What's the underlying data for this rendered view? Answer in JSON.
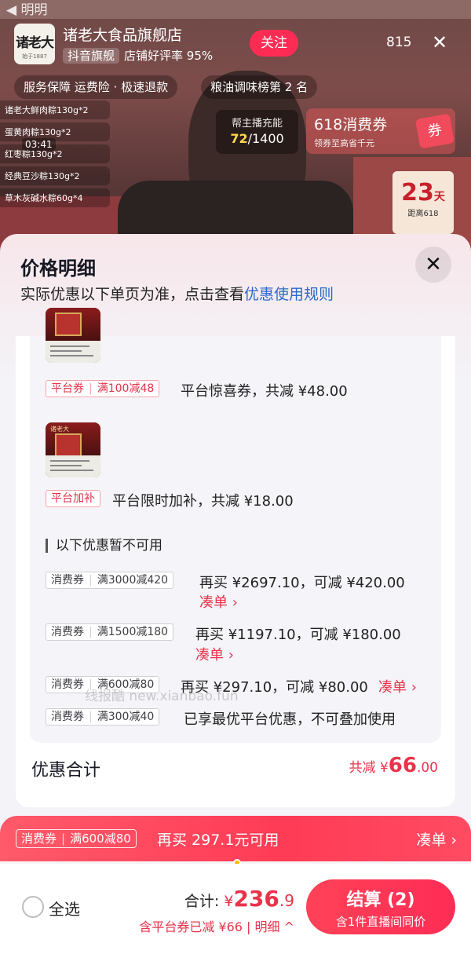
{
  "stream": {
    "top_strip": "◀ 明明",
    "shop_logo_text": "诸老大",
    "shop_logo_sub": "始于1887",
    "shop_name": "诸老大食品旗舰店",
    "shop_tag": "抖音旗舰",
    "shop_rating": "店铺好评率 95%",
    "follow": "关注",
    "viewers": "815",
    "service_chip": "服务保障  运费险 · 极速退款",
    "rank_chip": "粮油调味榜第 2 名",
    "product_items": [
      "诸老大鲜肉粽130g*2",
      "蛋黄肉粽130g*2",
      "红枣粽130g*2",
      "经典豆沙粽130g*2",
      "草木灰碱水粽60g*4"
    ],
    "video_time": "03:41",
    "help_title": "帮主播充能",
    "help_progress": "72",
    "help_total": "/1400",
    "coupon_title": "618消费券",
    "coupon_sub": "领券至高省千元",
    "coupon_mark": "券",
    "countdown_num": "23",
    "countdown_unit": "天",
    "countdown_sub": "距离618"
  },
  "sheet": {
    "title": "价格明细",
    "subtitle": "实际优惠以下单页为准，点击查看",
    "subtitle_link": "优惠使用规则",
    "close": "✕",
    "discounts": [
      {
        "type": "平台券",
        "rule": "满100减48",
        "desc": "平台惊喜券，共减 ¥48.00"
      },
      {
        "type": "平台加补",
        "desc": "平台限时加补，共减 ¥18.00"
      }
    ],
    "product_brand": "诸老大",
    "unavailable_title": "以下优惠暂不可用",
    "unavailable": [
      {
        "type": "消费券",
        "rule": "满3000减420",
        "desc": "再买 ¥2697.10，可减 ¥420.00",
        "action": "凑单 ›"
      },
      {
        "type": "消费券",
        "rule": "满1500减180",
        "desc": "再买 ¥1197.10，可减 ¥180.00",
        "action": "凑单 ›"
      },
      {
        "type": "消费券",
        "rule": "满600减80",
        "desc": "再买 ¥297.10，可减 ¥80.00",
        "action": "凑单 ›"
      },
      {
        "type": "消费券",
        "rule": "满300减40",
        "desc": "已享最优平台优惠，不可叠加使用"
      }
    ],
    "total_label": "优惠合计",
    "total_prefix": "共减 ¥",
    "total_int": "66",
    "total_dec": ".00",
    "watermark": "线报酷 new.xianbao.fun"
  },
  "promo": {
    "type": "消费券",
    "rule": "满600减80",
    "text": "再买 297.1元可用",
    "action": "凑单 ›"
  },
  "checkout": {
    "select_all": "全选",
    "sum_label": "合计: ",
    "currency": "¥",
    "amount_int": "236",
    "amount_dec": ".9",
    "detail": "含平台券已减 ¥66 | 明细 ^",
    "pay_label": "结算 (2)",
    "pay_sub": "含1件直播间同价"
  },
  "colors": {
    "accent": "#fe2c55",
    "price_red": "#e8334a",
    "link_blue": "#2b69c9"
  }
}
